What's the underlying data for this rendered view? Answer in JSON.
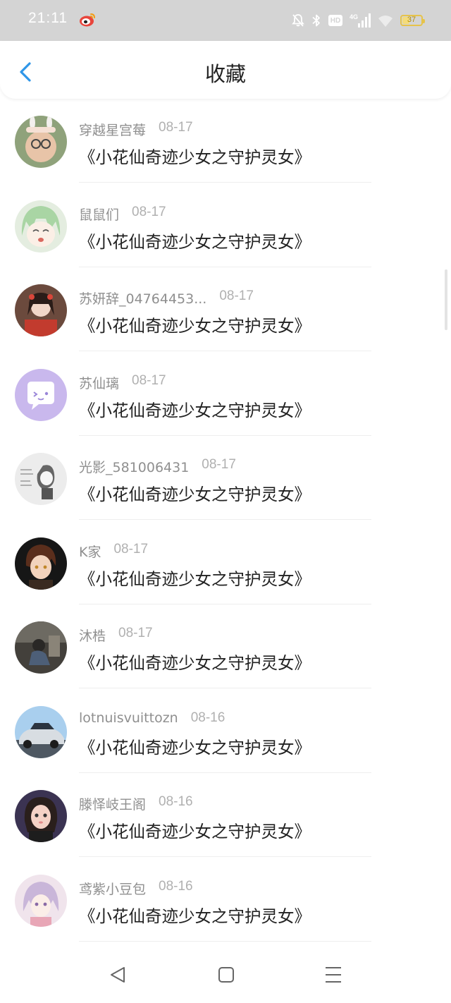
{
  "status_bar": {
    "time": "21:11",
    "battery": "37",
    "network": "4G",
    "hd": "HD",
    "icons": [
      "weibo-icon",
      "mute-bell-icon",
      "bluetooth-icon",
      "hd-icon",
      "signal-icon",
      "wifi-icon",
      "battery-icon"
    ],
    "battery_level": 0.37
  },
  "header": {
    "title": "收藏",
    "back_icon": "chevron-left-icon",
    "accent_color": "#2f96e8"
  },
  "favorites": [
    {
      "user": "穿越星宫莓",
      "date": "08-17",
      "title": "《小花仙奇迹少女之守护灵女》"
    },
    {
      "user": "鼠鼠们",
      "date": "08-17",
      "title": "《小花仙奇迹少女之守护灵女》"
    },
    {
      "user": "苏妍辞_04764453...",
      "date": "08-17",
      "title": "《小花仙奇迹少女之守护灵女》"
    },
    {
      "user": "苏仙璃",
      "date": "08-17",
      "title": "《小花仙奇迹少女之守护灵女》"
    },
    {
      "user": "光影_581006431",
      "date": "08-17",
      "title": "《小花仙奇迹少女之守护灵女》"
    },
    {
      "user": "K家",
      "date": "08-17",
      "title": "《小花仙奇迹少女之守护灵女》"
    },
    {
      "user": "沐梏",
      "date": "08-17",
      "title": "《小花仙奇迹少女之守护灵女》"
    },
    {
      "user": "lotnuisvuittozn",
      "date": "08-16",
      "title": "《小花仙奇迹少女之守护灵女》"
    },
    {
      "user": "滕怿岐王阁",
      "date": "08-16",
      "title": "《小花仙奇迹少女之守护灵女》"
    },
    {
      "user": "鸢紫小豆包",
      "date": "08-16",
      "title": "《小花仙奇迹少女之守护灵女》"
    }
  ],
  "nav_bar": {
    "icons": [
      "nav-back-icon",
      "nav-home-icon",
      "nav-menu-icon"
    ]
  }
}
